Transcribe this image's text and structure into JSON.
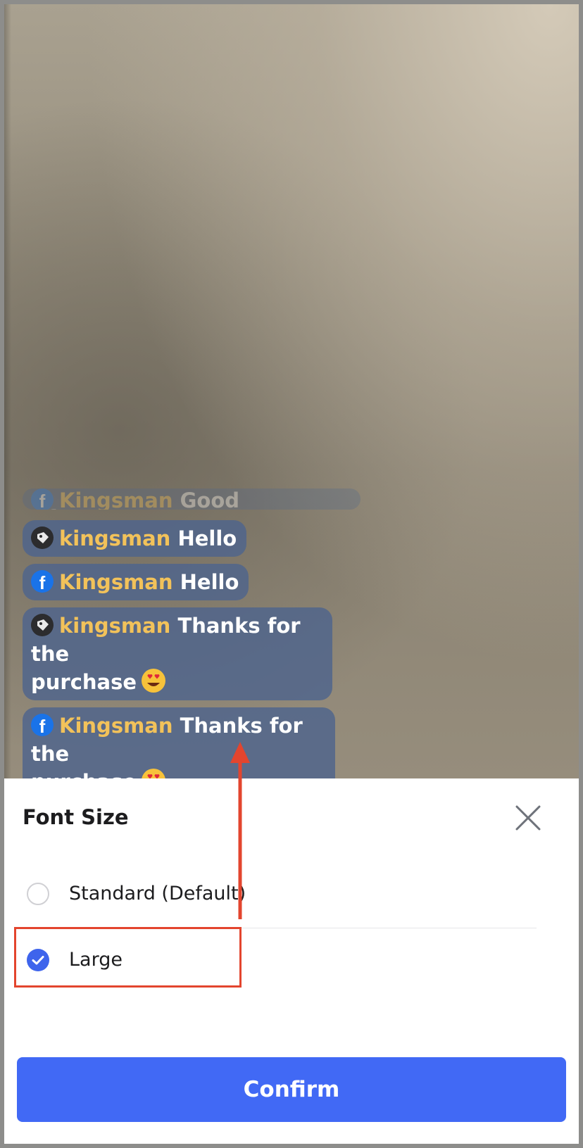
{
  "chat": {
    "messages": [
      {
        "platform": "facebook-icon",
        "name": "Kingsman",
        "text": "Good Afternoon",
        "faded": true
      },
      {
        "platform": "shop-tag-icon",
        "name": "kingsman",
        "text": "Hello"
      },
      {
        "platform": "facebook-icon",
        "name": "Kingsman",
        "text": "Hello"
      },
      {
        "platform": "shop-tag-icon",
        "name": "kingsman",
        "text": "Thanks for the",
        "text2": "purchase",
        "emoji": "heart-eyes-emoji"
      },
      {
        "platform": "facebook-icon",
        "name": "Kingsman",
        "text": "Thanks for the",
        "text2": "purchase",
        "emoji": "heart-eyes-emoji"
      }
    ]
  },
  "sheet": {
    "title": "Font Size",
    "options": [
      {
        "label": "Standard (Default)",
        "selected": false
      },
      {
        "label": "Large",
        "selected": true
      }
    ],
    "confirm_label": "Confirm"
  },
  "colors": {
    "accent": "#4169f5",
    "radio_on": "#3e64ec",
    "annotation": "#e3452e",
    "username": "#f2c25a",
    "chat_bubble": "#4e648c"
  },
  "icons": {
    "close": "close-icon",
    "checked": "check-icon"
  }
}
